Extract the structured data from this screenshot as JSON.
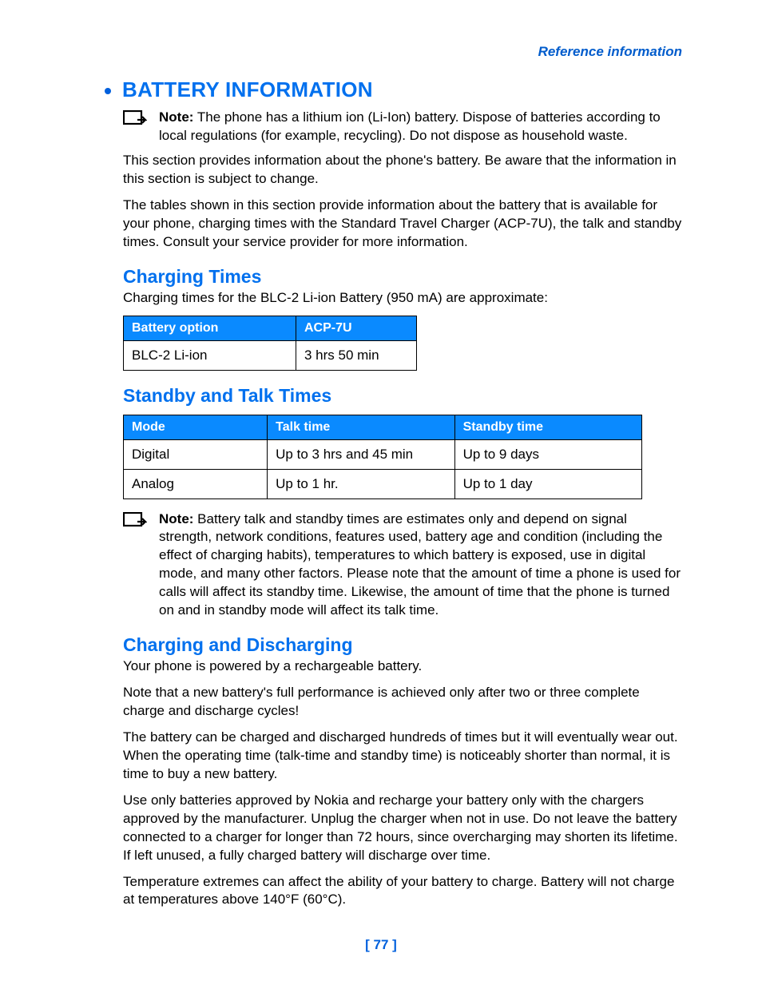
{
  "header": {
    "right": "Reference information"
  },
  "section": {
    "title": "BATTERY INFORMATION"
  },
  "note1": {
    "label": "Note:",
    "text": " The phone has a lithium ion (Li-Ion) battery. Dispose of batteries according to local regulations (for example, recycling). Do not dispose as household waste."
  },
  "intro1": "This section provides information about the phone's battery. Be aware that the information in this section is subject to change.",
  "intro2": "The tables shown in this section provide information about the battery that is available for your phone, charging times with the Standard Travel Charger (ACP-7U), the talk and standby times. Consult your service provider for more information.",
  "charging": {
    "title": "Charging Times",
    "desc": "Charging times for the BLC-2 Li-ion Battery (950 mA) are approximate:",
    "headers": [
      "Battery option",
      "ACP-7U"
    ],
    "row": [
      "BLC-2 Li-ion",
      "3 hrs 50 min"
    ]
  },
  "standby": {
    "title": "Standby and Talk Times",
    "headers": [
      "Mode",
      "Talk time",
      "Standby time"
    ],
    "rows": [
      [
        "Digital",
        "Up to 3 hrs and 45 min",
        "Up to 9 days"
      ],
      [
        "Analog",
        "Up to 1 hr.",
        "Up to 1 day"
      ]
    ]
  },
  "note2": {
    "label": "Note:",
    "text": " Battery talk and standby times are estimates only and depend on signal strength, network conditions, features used, battery age and condition (including the effect of charging habits), temperatures to which battery is exposed, use in digital mode, and many other factors. Please note that the amount of time a phone is used for calls will affect its standby time. Likewise, the amount of time that the phone is turned on and in standby mode will affect its talk time."
  },
  "cd": {
    "title": "Charging and Discharging",
    "p1": "Your phone is powered by a rechargeable battery.",
    "p2": "Note that a new battery's full performance is achieved only after two or three complete charge and discharge cycles!",
    "p3": "The battery can be charged and discharged hundreds of times but it will eventually wear out. When the operating time (talk-time and standby time) is noticeably shorter than normal, it is time to buy a new battery.",
    "p4": "Use only batteries approved by Nokia and recharge your battery only with the chargers approved by the manufacturer. Unplug the charger when not in use. Do not leave the battery connected to a charger for longer than 72 hours, since overcharging may shorten its lifetime. If left unused, a fully charged battery will discharge over time.",
    "p5": "Temperature extremes can affect the ability of your battery to charge. Battery will not charge at temperatures above 140°F (60°C)."
  },
  "pageNumber": "[ 77 ]"
}
